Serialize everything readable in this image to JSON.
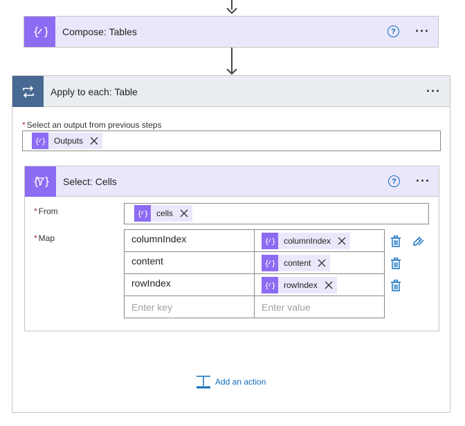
{
  "compose": {
    "title": "Compose: Tables"
  },
  "apply_to_each": {
    "title": "Apply to each: Table",
    "output_label": "Select an output from previous steps",
    "output_token": "Outputs"
  },
  "select": {
    "title": "Select: Cells",
    "from_label": "From",
    "from_token": "cells",
    "map_label": "Map",
    "rows": [
      {
        "key": "columnIndex",
        "value": "columnIndex"
      },
      {
        "key": "content",
        "value": "content"
      },
      {
        "key": "rowIndex",
        "value": "rowIndex"
      }
    ],
    "key_placeholder": "Enter key",
    "value_placeholder": "Enter value"
  },
  "add_action": {
    "label": "Add an action"
  },
  "icons": {
    "help": "help-icon",
    "more": "more-options-icon",
    "delete": "trash-icon",
    "switch_mode": "switch-to-text-mode-icon",
    "expression_token": "expression-icon",
    "loop": "loop-icon",
    "add_action": "add-action-icon"
  },
  "colors": {
    "data_operation": "#8c6cf3",
    "data_operation_tint": "#ebe7fb",
    "control": "#486991",
    "control_tint": "#e9edf2",
    "accent": "#0f6cbd"
  }
}
